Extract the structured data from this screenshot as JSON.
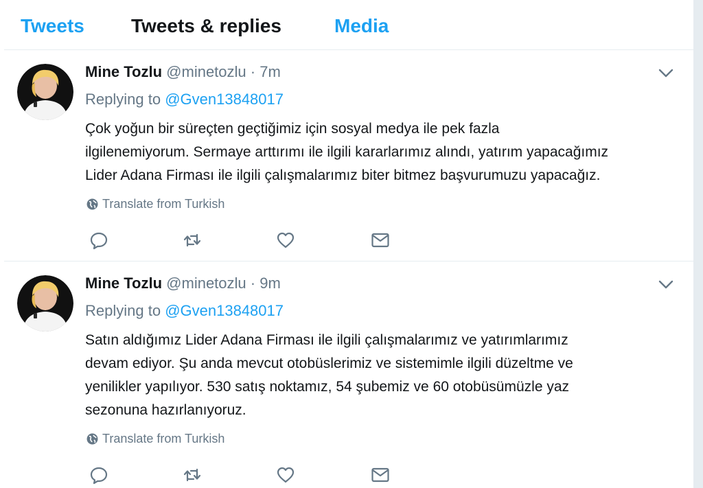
{
  "tabs": [
    {
      "label": "Tweets"
    },
    {
      "label": "Tweets & replies"
    },
    {
      "label": "Media"
    }
  ],
  "tweets": [
    {
      "name": "Mine Tozlu",
      "handle": "@minetozlu",
      "separator": "·",
      "time": "7m",
      "replying_prefix": "Replying to",
      "replying_to": "@Gven13848017",
      "lines": [
        "Çok yoğun bir süreçten geçtiğimiz için sosyal medya ile pek fazla",
        "ilgilenemiyorum. Sermaye arttırımı ile ilgili kararlarımız alındı, yatırım yapacağımız",
        "Lider Adana Firması ile ilgili çalışmalarımız biter bitmez başvurumuzu yapacağız."
      ],
      "translate": "Translate from Turkish"
    },
    {
      "name": "Mine Tozlu",
      "handle": "@minetozlu",
      "separator": "·",
      "time": "9m",
      "replying_prefix": "Replying to",
      "replying_to": "@Gven13848017",
      "lines": [
        "Satın aldığımız Lider Adana Firması ile ilgili çalışmalarımız ve yatırımlarımız",
        "devam ediyor. Şu anda mevcut otobüslerimiz ve sistemimle ilgili düzeltme ve",
        "yenilikler yapılıyor. 530  satış noktamız, 54 şubemiz ve 60 otobüsümüzle yaz",
        "sezonuna hazırlanıyoruz."
      ],
      "translate": "Translate from Turkish"
    }
  ],
  "colors": {
    "accent": "#1da1f2",
    "text": "#14171a",
    "muted": "#657786",
    "divider": "#e6ecf0"
  },
  "icons": [
    "chevron-down-icon",
    "globe-icon",
    "reply-icon",
    "retweet-icon",
    "heart-icon",
    "envelope-icon"
  ]
}
